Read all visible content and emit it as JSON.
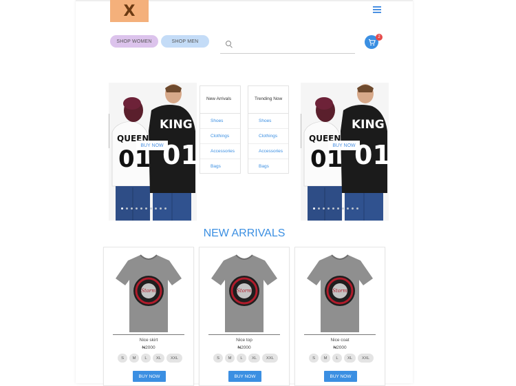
{
  "header": {
    "logo_text": "X",
    "menu_icon": "hamburger-icon",
    "cart_icon": "cart-icon",
    "cart_count": "2",
    "accent_color": "#3b8fe2"
  },
  "nav": {
    "shop_women": "SHOP WOMEN",
    "shop_men": "SHOP MEN"
  },
  "search": {
    "icon": "search-icon",
    "value": "",
    "placeholder": ""
  },
  "hero": {
    "buy_now": "BUY NOW",
    "slide_count": 10,
    "active_slide": 1,
    "shirt_labels": [
      "QUEEN",
      "01",
      "KING",
      "01"
    ]
  },
  "categories": [
    {
      "title": "New Arrivals",
      "links": [
        "Shoes",
        "Clothings",
        "Accessories",
        "Bags"
      ]
    },
    {
      "title": "Trending Now",
      "links": [
        "Shoes",
        "Clothings",
        "Accessories",
        "Bags"
      ]
    }
  ],
  "section": {
    "title": "NEW ARRIVALS"
  },
  "products": [
    {
      "name": "Nice skirt",
      "price": "₦2000",
      "sizes": [
        "S",
        "M",
        "L",
        "XL",
        "XXL"
      ],
      "button": "BUY NOW"
    },
    {
      "name": "Nice top",
      "price": "₦2000",
      "sizes": [
        "S",
        "M",
        "L",
        "XL",
        "XXL"
      ],
      "button": "BUY NOW"
    },
    {
      "name": "Nice coat",
      "price": "₦2000",
      "sizes": [
        "S",
        "M",
        "L",
        "XL",
        "XXL"
      ],
      "button": "BUY NOW"
    }
  ]
}
